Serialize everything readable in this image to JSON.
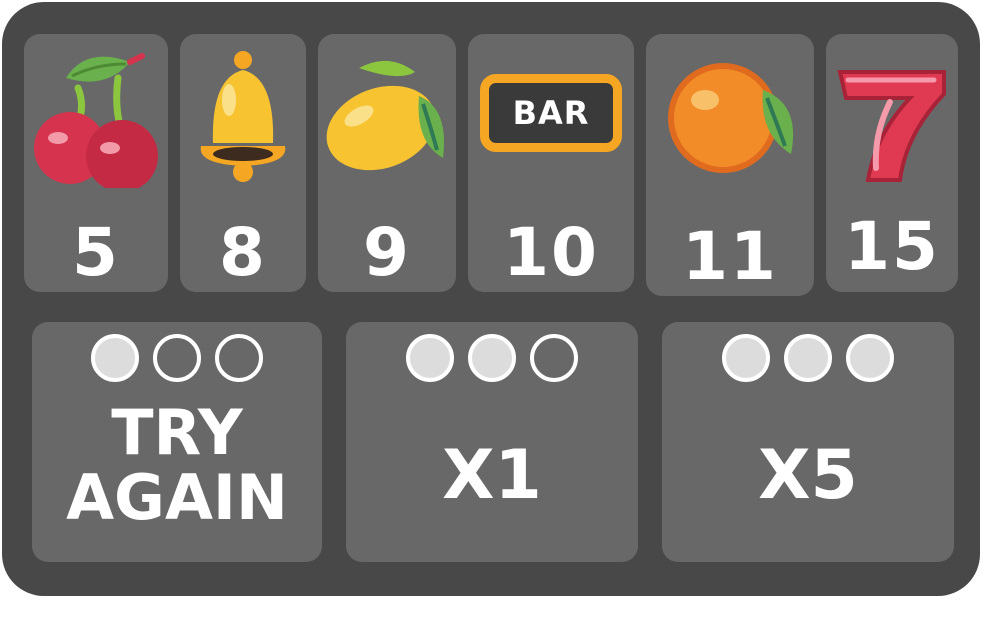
{
  "paytable": [
    {
      "symbol": "cherry-icon",
      "value": "5"
    },
    {
      "symbol": "bell-icon",
      "value": "8"
    },
    {
      "symbol": "lemon-icon",
      "value": "9"
    },
    {
      "symbol": "bar-icon",
      "value": "10",
      "symbol_text": "BAR"
    },
    {
      "symbol": "orange-icon",
      "value": "11"
    },
    {
      "symbol": "seven-icon",
      "value": "15"
    }
  ],
  "outcomes": [
    {
      "label_line1": "TRY",
      "label_line2": "AGAIN",
      "matches": 1,
      "slots": 3
    },
    {
      "label": "X1",
      "matches": 2,
      "slots": 3
    },
    {
      "label": "X5",
      "matches": 3,
      "slots": 3
    }
  ],
  "colors": {
    "board": "#484848",
    "card": "#686868",
    "dot_filled": "#dcdcdc",
    "text": "#ffffff"
  }
}
